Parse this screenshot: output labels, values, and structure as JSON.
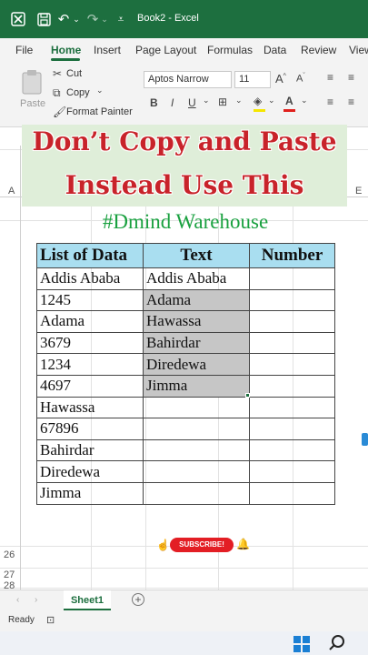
{
  "titlebar": {
    "title": "Book2  -  Excel",
    "icons": [
      "excel-logo-icon",
      "save-icon",
      "undo-icon",
      "redo-icon",
      "customize-qat-icon"
    ]
  },
  "tabs": [
    "File",
    "Home",
    "Insert",
    "Page Layout",
    "Formulas",
    "Data",
    "Review",
    "View"
  ],
  "active_tab": "Home",
  "ribbon": {
    "paste": "Paste",
    "cut": "Cut",
    "copy": "Copy",
    "format_painter": "Format Painter",
    "font_name": "Aptos Narrow",
    "font_size": "11",
    "bold": "B",
    "italic": "I",
    "underline": "U"
  },
  "overlay": {
    "line1": "Don’t Copy and Paste",
    "line2": "Instead Use This"
  },
  "columns": [
    "A",
    "E"
  ],
  "subtitle": "#Dmind Warehouse",
  "table": {
    "headers": [
      "List of Data",
      "Text",
      "Number"
    ],
    "rows": [
      [
        "Addis Ababa",
        "Addis Ababa",
        ""
      ],
      [
        "1245",
        "Adama",
        ""
      ],
      [
        "Adama",
        "Hawassa",
        ""
      ],
      [
        "3679",
        "Bahirdar",
        ""
      ],
      [
        "1234",
        "Diredewa",
        ""
      ],
      [
        "4697",
        "Jimma",
        ""
      ],
      [
        "Hawassa",
        "",
        ""
      ],
      [
        "67896",
        "",
        ""
      ],
      [
        "Bahirdar",
        "",
        ""
      ],
      [
        "Diredewa",
        "",
        ""
      ],
      [
        "Jimma",
        "",
        ""
      ]
    ]
  },
  "row_numbers": [
    "26",
    "27",
    "28"
  ],
  "subscribe": "SUBSCRIBE!",
  "sheet_tab": "Sheet1",
  "status": "Ready",
  "colors": {
    "excel_green": "#1d6f3f",
    "header_blue": "#a9def0",
    "title_red": "#c8232a",
    "subtitle_green": "#1aa140",
    "selection_grey": "#c6c6c6"
  }
}
